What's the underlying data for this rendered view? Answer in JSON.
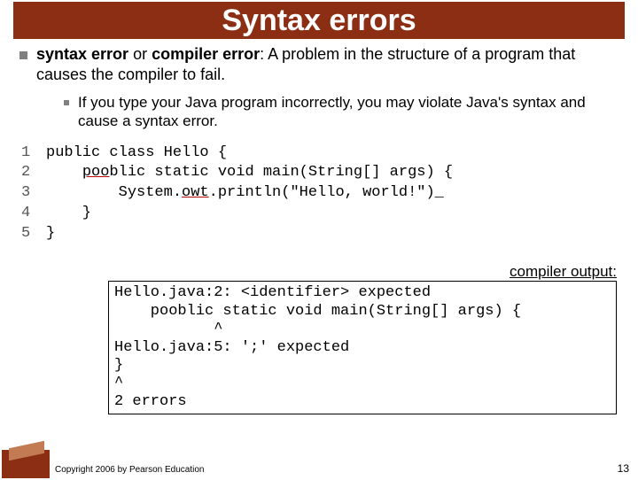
{
  "title": "Syntax errors",
  "bullet1": {
    "term": "syntax error",
    "or": " or ",
    "term2": "compiler error",
    "rest": ": A problem in the structure of a program that causes the compiler to fail."
  },
  "subbullet": "If you type your Java program incorrectly, you may violate Java's syntax and cause a syntax error.",
  "code": {
    "lines": [
      {
        "n": "1",
        "pre": "public class Hello {",
        "err": "",
        "post": ""
      },
      {
        "n": "2",
        "pre": "    ",
        "err": "poo",
        "post": "blic static void main(String[] args) {"
      },
      {
        "n": "3",
        "pre": "        System.",
        "err": "owt",
        "post": ".println(\"Hello, world!\")_"
      },
      {
        "n": "4",
        "pre": "    }",
        "err": "",
        "post": ""
      },
      {
        "n": "5",
        "pre": "}",
        "err": "",
        "post": ""
      }
    ]
  },
  "out_label": "compiler output:",
  "compiler_output": "Hello.java:2: <identifier> expected\n    pooblic static void main(String[] args) {\n           ^\nHello.java:5: ';' expected\n}\n^\n2 errors",
  "footer": "Copyright 2006 by Pearson Education",
  "page": "13"
}
